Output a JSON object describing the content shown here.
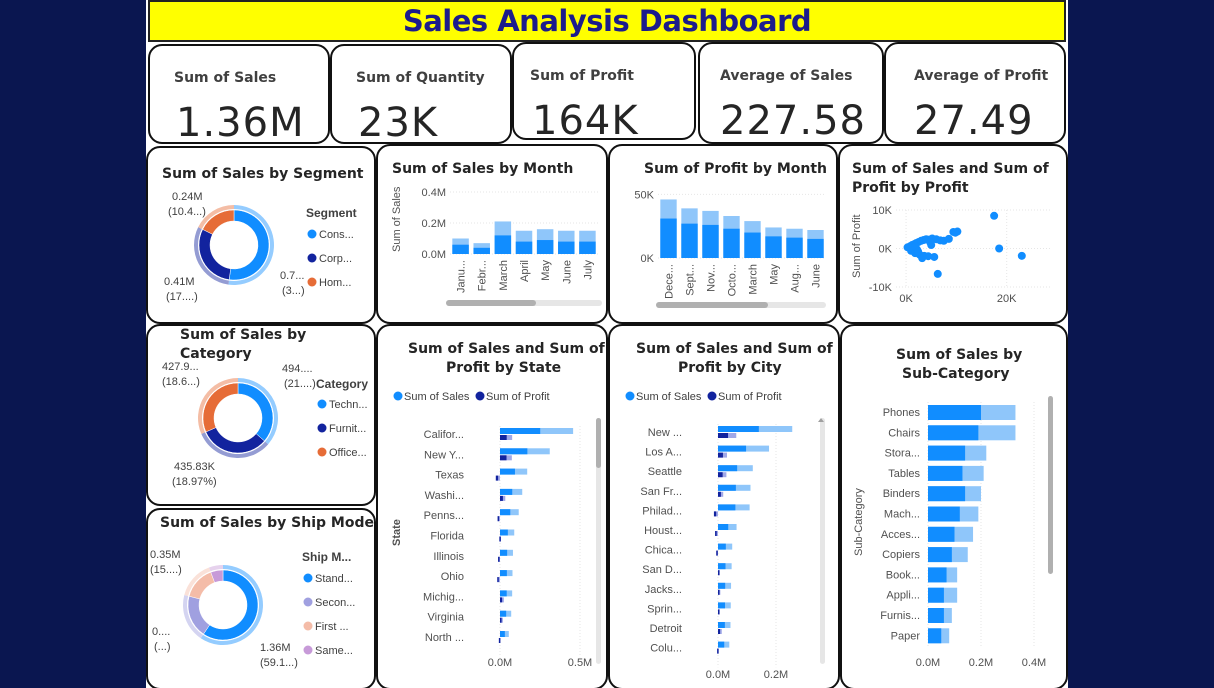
{
  "dashboard": {
    "title": "Sales Analysis Dashboard"
  },
  "kpis": [
    {
      "label": "Sum of Sales",
      "value": "1.36M"
    },
    {
      "label": "Sum of Quantity",
      "value": "23K"
    },
    {
      "label": "Sum of Profit",
      "value": "164K"
    },
    {
      "label": "Average of Sales",
      "value": "227.58"
    },
    {
      "label": "Average of Profit",
      "value": "27.49"
    }
  ],
  "segment_visual": {
    "title": "Sum of Sales by Segment",
    "legend_title": "Segment",
    "legend": [
      "Cons...",
      "Corp...",
      "Hom..."
    ],
    "slice_labels": [
      [
        "0.7...",
        "(3...)"
      ],
      [
        "0.41M",
        "(17....)"
      ],
      [
        "0.24M",
        "(10.4...)"
      ]
    ]
  },
  "category_visual": {
    "title": "Sum of Sales by Category",
    "legend_title": "Category",
    "legend": [
      "Techn...",
      "Furnit...",
      "Office..."
    ],
    "slice_labels": [
      [
        "494....",
        "(21....)"
      ],
      [
        "435.83K",
        "(18.97%)"
      ],
      [
        "427.9...",
        "(18.6...)"
      ]
    ]
  },
  "shipmode_visual": {
    "title": "Sum of Sales by Ship Mode",
    "legend_title": "Ship M...",
    "legend": [
      "Stand...",
      "Secon...",
      "First ...",
      "Same..."
    ],
    "slice_labels": [
      [
        "1.36M",
        "(59.1...)"
      ],
      [
        "0....",
        "(...)"
      ],
      [
        "0.35M",
        "(15....)"
      ]
    ]
  },
  "month_sales_visual": {
    "title": "Sum of Sales by Month",
    "y_axis_label": "Sum of Sales"
  },
  "month_profit_visual": {
    "title": "Sum of Profit by Month"
  },
  "scatter_visual": {
    "title_line1": "Sum of Sales and Sum of",
    "title_line2": "Profit by Profit",
    "y_axis_label": "Sum of Profit"
  },
  "state_visual": {
    "title_line1": "Sum of Sales and Sum of",
    "title_line2": "Profit by State",
    "legend": [
      "Sum of Sales",
      "Sum of Profit"
    ],
    "y_axis_label": "State"
  },
  "city_visual": {
    "title_line1": "Sum of Sales and Sum of",
    "title_line2": "Profit by City",
    "legend": [
      "Sum of Sales",
      "Sum of Profit"
    ]
  },
  "subcat_visual": {
    "title_line1": "Sum of Sales by",
    "title_line2": "Sub-Category",
    "y_axis_label": "Sub-Category"
  },
  "chart_data": [
    {
      "id": "segment",
      "type": "pie",
      "categories": [
        "Consumer",
        "Corporate",
        "Home Office"
      ],
      "values": [
        0.71,
        0.41,
        0.24
      ],
      "colors": [
        "#118dff",
        "#12239e",
        "#e66c37"
      ]
    },
    {
      "id": "category",
      "type": "pie",
      "categories": [
        "Technology",
        "Furniture",
        "Office Supplies"
      ],
      "values": [
        494,
        435.83,
        427.9
      ],
      "colors": [
        "#118dff",
        "#12239e",
        "#e66c37"
      ]
    },
    {
      "id": "shipmode",
      "type": "pie",
      "categories": [
        "Standard Class",
        "Second Class",
        "First Class",
        "Same Day"
      ],
      "values": [
        1.36,
        0.45,
        0.35,
        0.13
      ],
      "colors": [
        "#118dff",
        "#a0a0e0",
        "#f4bca8",
        "#c79ad8"
      ]
    },
    {
      "id": "sales_by_month",
      "type": "bar",
      "categories": [
        "Janu...",
        "Febr...",
        "March",
        "April",
        "May",
        "June",
        "July"
      ],
      "series": [
        {
          "name": "Sum of Sales",
          "values": [
            0.1,
            0.07,
            0.21,
            0.15,
            0.16,
            0.15,
            0.15
          ]
        },
        {
          "name": "Sum of Sales (highlight)",
          "values": [
            0.06,
            0.04,
            0.12,
            0.08,
            0.09,
            0.08,
            0.08
          ]
        }
      ],
      "yticks": [
        "0.0M",
        "0.2M",
        "0.4M"
      ],
      "ylim": [
        0,
        0.4
      ]
    },
    {
      "id": "profit_by_month",
      "type": "bar",
      "categories": [
        "Dece...",
        "Sept...",
        "Nov...",
        "Octo...",
        "March",
        "May",
        "Aug...",
        "June"
      ],
      "series": [
        {
          "name": "Sum of Profit",
          "values": [
            46,
            39,
            37,
            33,
            29,
            24,
            23,
            22
          ]
        },
        {
          "name": "Sum of Profit (highlight)",
          "values": [
            31,
            27,
            26,
            23,
            20,
            17,
            16,
            15
          ]
        }
      ],
      "yticks": [
        "0K",
        "50K"
      ],
      "ylim": [
        0,
        55
      ]
    },
    {
      "id": "scatter_profit",
      "type": "scatter",
      "x": [
        0.3,
        0.8,
        1.2,
        1.6,
        2.0,
        2.5,
        3.0,
        3.5,
        4.0,
        4.6,
        5.2,
        6.0,
        6.8,
        7.5,
        8.5,
        9.4,
        10.2,
        1.0,
        1.8,
        2.7,
        3.6,
        4.4,
        5.6,
        6.3,
        17.5,
        18.5,
        23.0,
        1.4,
        2.2,
        3.2,
        0.6,
        1.9,
        4.8,
        9.8,
        2.4,
        5.0
      ],
      "y": [
        0.3,
        0.6,
        0.9,
        1.1,
        1.4,
        1.7,
        2.0,
        2.2,
        2.4,
        2.3,
        2.6,
        2.4,
        2.1,
        2.0,
        2.5,
        4.3,
        4.4,
        -0.6,
        -1.2,
        -1.6,
        -1.9,
        -2.0,
        -2.2,
        -6.6,
        8.5,
        0.0,
        -1.9,
        0.1,
        -0.3,
        -2.5,
        0.2,
        0.5,
        1.6,
        4.1,
        -0.8,
        0.9
      ],
      "xticks": [
        "0K",
        "20K"
      ],
      "yticks": [
        "10K",
        "0K",
        "-10K"
      ],
      "xlim": [
        -2,
        29
      ],
      "ylim": [
        -10,
        10
      ]
    },
    {
      "id": "state",
      "type": "bar",
      "orientation": "horizontal",
      "categories": [
        "Califor...",
        "New Y...",
        "Texas",
        "Washi...",
        "Penns...",
        "Florida",
        "Illinois",
        "Ohio",
        "Michig...",
        "Virginia",
        "North ..."
      ],
      "series": [
        {
          "name": "Sum of Sales",
          "values": [
            0.457,
            0.311,
            0.17,
            0.139,
            0.117,
            0.089,
            0.081,
            0.078,
            0.076,
            0.07,
            0.055
          ]
        },
        {
          "name": "Sum of Profit",
          "values": [
            0.076,
            0.074,
            -0.026,
            0.033,
            -0.015,
            -0.004,
            -0.012,
            -0.017,
            0.024,
            0.018,
            -0.007
          ]
        }
      ],
      "xticks": [
        "0.0M",
        "0.5M"
      ],
      "xlim": [
        0,
        0.5
      ]
    },
    {
      "id": "city",
      "type": "bar",
      "orientation": "horizontal",
      "categories": [
        "New ...",
        "Los A...",
        "Seattle",
        "San Fr...",
        "Philad...",
        "Houst...",
        "Chica...",
        "San D...",
        "Jacks...",
        "Sprin...",
        "Detroit",
        "Colu..."
      ],
      "series": [
        {
          "name": "Sum of Sales",
          "values": [
            0.256,
            0.176,
            0.12,
            0.112,
            0.109,
            0.064,
            0.049,
            0.047,
            0.045,
            0.044,
            0.043,
            0.039
          ]
        },
        {
          "name": "Sum of Profit",
          "values": [
            0.063,
            0.031,
            0.029,
            0.018,
            -0.014,
            -0.01,
            -0.006,
            0.006,
            0.008,
            0.006,
            0.013,
            -0.003
          ]
        }
      ],
      "xticks": [
        "0.0M",
        "0.2M"
      ],
      "xlim": [
        0,
        0.2
      ]
    },
    {
      "id": "subcategory",
      "type": "bar",
      "orientation": "horizontal",
      "categories": [
        "Phones",
        "Chairs",
        "Stora...",
        "Tables",
        "Binders",
        "Mach...",
        "Acces...",
        "Copiers",
        "Book...",
        "Appli...",
        "Furnis...",
        "Paper"
      ],
      "series": [
        {
          "name": "Sum of Sales",
          "values": [
            0.33,
            0.33,
            0.22,
            0.21,
            0.2,
            0.19,
            0.17,
            0.15,
            0.11,
            0.11,
            0.09,
            0.08
          ]
        },
        {
          "name": "Sum of Sales (highlight)",
          "values": [
            0.2,
            0.19,
            0.14,
            0.13,
            0.14,
            0.12,
            0.1,
            0.09,
            0.07,
            0.06,
            0.06,
            0.05
          ]
        }
      ],
      "xticks": [
        "0.0M",
        "0.2M",
        "0.4M"
      ],
      "xlim": [
        0,
        0.4
      ]
    }
  ]
}
